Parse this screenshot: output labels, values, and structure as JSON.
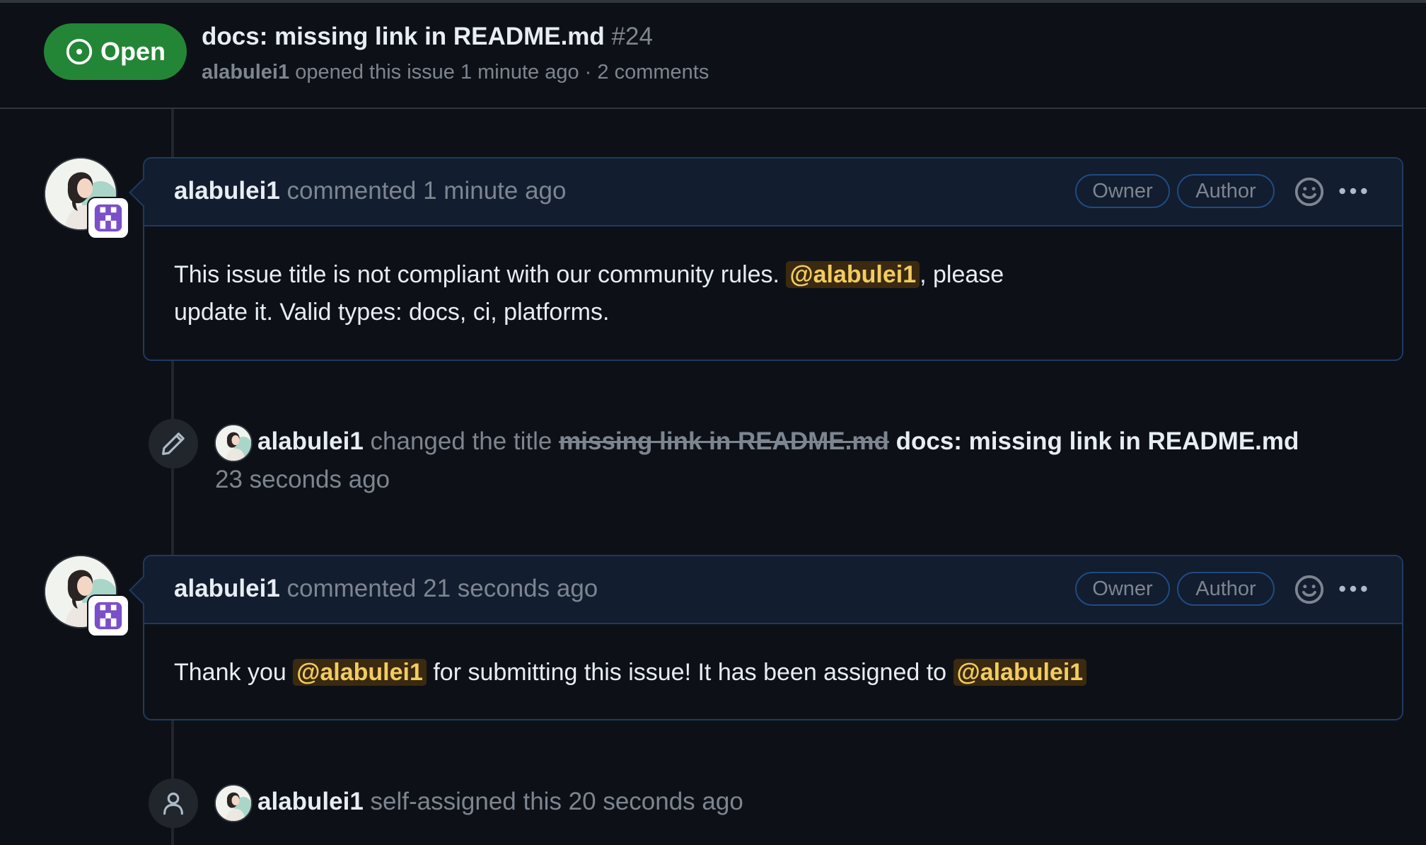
{
  "issue": {
    "state": "Open",
    "title": "docs: missing link in README.md",
    "number": "#24",
    "author": "alabulei1",
    "opened_text": "opened this issue 1 minute ago · 2 comments"
  },
  "comments": [
    {
      "author": "alabulei1",
      "action": "commented 1 minute ago",
      "badges": [
        "Owner",
        "Author"
      ],
      "body_part1": "This issue title is not compliant with our community rules. ",
      "mention1": "@alabulei1",
      "body_part2": ", please update it. Valid types: docs, ci, platforms."
    },
    {
      "author": "alabulei1",
      "action": "commented 21 seconds ago",
      "badges": [
        "Owner",
        "Author"
      ],
      "body_part1": "Thank you ",
      "mention1": "@alabulei1",
      "body_part2": " for submitting this issue! It has been assigned to ",
      "mention2": "@alabulei1"
    }
  ],
  "events": [
    {
      "author": "alabulei1",
      "action": "changed the title",
      "old_title": "missing link in README.md",
      "new_title": "docs: missing link in README.md",
      "time": "23 seconds ago",
      "icon": "pencil-icon"
    },
    {
      "author": "alabulei1",
      "action": "self-assigned this 20 seconds ago",
      "icon": "person-icon"
    }
  ],
  "colors": {
    "background": "#0d1117",
    "open_badge": "#238636",
    "comment_header": "#121d2f",
    "comment_border": "#1f3a63",
    "mention_bg": "#3b2a10",
    "mention_text": "#f2cc60",
    "muted_text": "#7d8590"
  }
}
